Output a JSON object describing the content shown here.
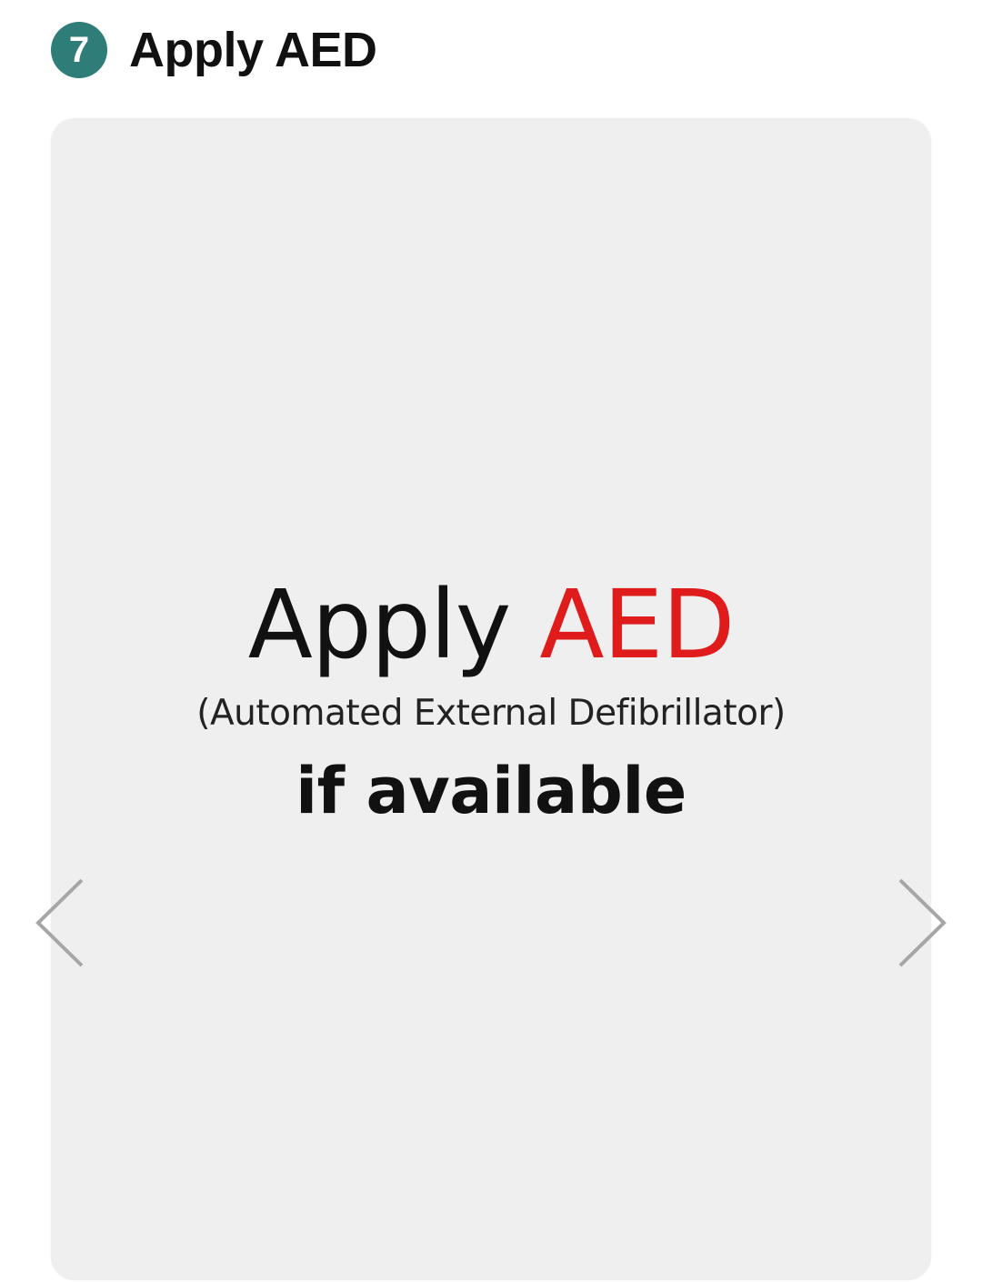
{
  "step": {
    "number": "7",
    "title": "Apply AED"
  },
  "slide": {
    "line1_main": "Apply",
    "line1_accent": "AED",
    "line2": "(Automated External Defibrillator)",
    "line3": "if available"
  },
  "carousel": {
    "prev_icon": "chevron-left-icon",
    "next_icon": "chevron-right-icon"
  },
  "colors": {
    "badge": "#2f7d78",
    "accent": "#e01b1b",
    "card_background": "#efefef",
    "arrow": "#a6a6a6"
  }
}
